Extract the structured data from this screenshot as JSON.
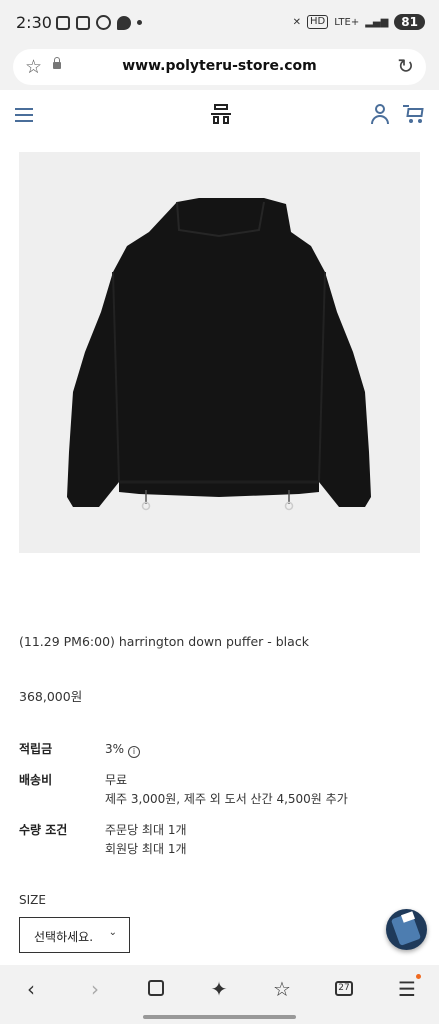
{
  "status_bar": {
    "time": "2:30",
    "network": "LTE+",
    "hd": "HD",
    "battery": "81"
  },
  "browser": {
    "url": "www.polyteru-store.com"
  },
  "product": {
    "name": "(11.29 PM6:00) harrington down puffer - black",
    "price": "368,000원"
  },
  "info": [
    {
      "label": "적립금",
      "lines": [
        "3%"
      ]
    },
    {
      "label": "배송비",
      "lines": [
        "무료",
        "제주 3,000원, 제주 외 도서 산간 4,500원 추가"
      ]
    },
    {
      "label": "수량 조건",
      "lines": [
        "주문당 최대 1개",
        "회원당 최대 1개"
      ]
    }
  ],
  "size": {
    "label": "SIZE",
    "placeholder": "선택하세요."
  },
  "nav": {
    "tab_count": "27"
  },
  "icons": {
    "info": "info-icon",
    "back": "back-arrow-icon",
    "forward": "forward-arrow-icon",
    "home": "home-icon",
    "ai": "sparkle-icon",
    "bookmarks": "bookmark-star-icon",
    "tabs": "tabs-icon",
    "menu": "menu-icon"
  }
}
